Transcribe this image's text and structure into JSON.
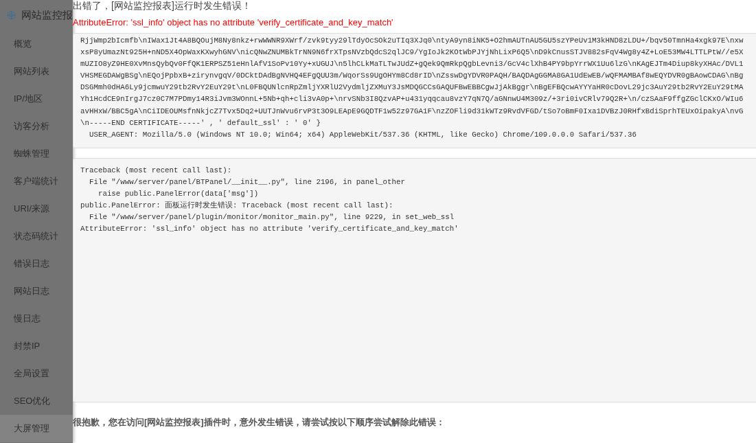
{
  "sidebar": {
    "title": "网站监控报",
    "items": [
      {
        "label": "概览",
        "selected": false
      },
      {
        "label": "网站列表",
        "selected": false
      },
      {
        "label": "IP/地区",
        "selected": false
      },
      {
        "label": "访客分析",
        "selected": false
      },
      {
        "label": "蜘蛛管理",
        "selected": false
      },
      {
        "label": "客户端统计",
        "selected": false
      },
      {
        "label": "URI/来源",
        "selected": false
      },
      {
        "label": "状态码统计",
        "selected": false
      },
      {
        "label": "错误日志",
        "selected": false
      },
      {
        "label": "网站日志",
        "selected": false
      },
      {
        "label": "慢日志",
        "selected": false
      },
      {
        "label": "封禁IP",
        "selected": false
      },
      {
        "label": "全局设置",
        "selected": false
      },
      {
        "label": "SEO优化",
        "selected": false
      },
      {
        "label": "大屏管理",
        "selected": true
      }
    ]
  },
  "error": {
    "heading": "出错了，[网站监控报表]运行时发生错误！",
    "message": "AttributeError: 'ssl_info' object has no attribute 'verify_certificate_and_key_match'",
    "request_lines": [
      "RjjWmp2bIcmfb\\nIWax1Jt4A8BQOujM8Ny8nkz+rwWWNR9XWrf/zvk9tyy29lTdyOcSOk2uTIq3XJq0\\ntyA9yn8iNK5+O2hmAUTnAU5GU5szYPeUv1M3kHND8zLDU+/bqv50TmnHa4xgk97E\\nxw",
      "xsP8yUmazNt925H+nND5X4OpWaxKXwyhGNV\\nicQNwZNUMBkTrNN9N6frXTpsNVzbQdcS2qlJC9/YgIoJk2KOtWbPJYjNhLixP6Q5\\nD9kCnusSTJV882sFqV4Wg8y4Z+LoE53MW4LTTLPtW//e5X",
      "mUZIO8yZ9HE0XvMnsQybQv0FfQK1ERPSZ51eHnlAfV1SoPv10Yy+xUGUJ\\n5lhCLkMaTLTwJUdZ+gQek9QmRkpQgbLevni3/GcV4clXhB4PY9bpYrrWX1Uu6lzG\\nKAgEJTm4Diup8kyXHAc/DVL1",
      "VHSMEGDAWgBSg\\nEQojPpbxB+zirynvgqV/0DCktDAdBgNVHQ4EFgQUU3m/WqorSs9UgOHYm8Cd8rID\\nZsswDgYDVR0PAQH/BAQDAgGGMA8GA1UdEwEB/wQFMAMBAf8wEQYDVR0gBAowCDAG\\nBg",
      "DSGMmh0dHA6Ly9jcmwuY29tb2RvY2EuY29t\\nL0FBQUNlcnRpZmljYXRlU2VydmljZXMuY3JsMDQGCCsGAQUFBwEBBCgwJjAkBggr\\nBgEFBQcwAYYYaHR0cDovL29jc3AuY29tb2RvY2EuY29tMA",
      "Yh1HcdCE9nIrgJ7cz0C7M7PDmy14R3iJvm3WOnnL+5Nb+qh+cli3vA0p+\\nrvSNb3I8QzvAP+u431yqqcau8vzY7qN7Q/aGNnwU4M309z/+3ri0ivCRlv79Q2R+\\n/czSAaF9ffgZGclCKxO/WIu6",
      "avHHxW/BBC5gA\\nCiIDEOUMsfnNkjcZ7Tvx5Dq2+UUTJnWvu6rvP3t3O9LEApE9GQDTF1w52z97GA1F\\nzZOFli9d31kWTz9RvdVFGD/tSo7oBmF0Ixa1DVBzJ0RHfxBdiSprhTEUxOipakyA\\nvG",
      "\\n-----END CERTIFICATE-----' , ' default_ssl' : ' 0' }",
      "  USER_AGENT: Mozilla/5.0 (Windows NT 10.0; Win64; x64) AppleWebKit/537.36 (KHTML, like Gecko) Chrome/109.0.0.0 Safari/537.36"
    ],
    "traceback_lines": [
      "Traceback (most recent call last):",
      "  File \"/www/server/panel/BTPanel/__init__.py\", line 2196, in panel_other",
      "    raise public.PanelError(data['msg'])",
      "public.PanelError: 面板运行时发生错误: Traceback (most recent call last):",
      "  File \"/www/server/panel/plugin/monitor/monitor_main.py\", line 9229, in set_web_ssl",
      "AttributeError: 'ssl_info' object has no attribute 'verify_certificate_and_key_match'"
    ],
    "apology": "很抱歉，您在访问[网站监控报表]插件时，意外发生错误，请尝试按以下顺序尝试解除此错误："
  }
}
